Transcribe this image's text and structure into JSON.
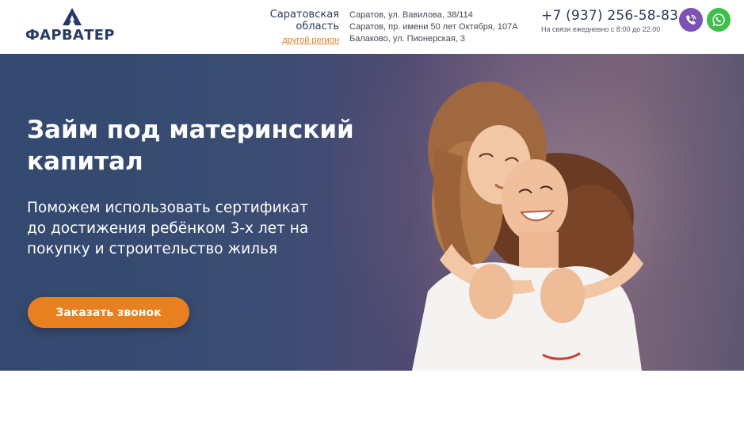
{
  "brand": {
    "name": "ФАРВАТЕР",
    "color": "#253A66"
  },
  "region": {
    "name": "Саратовская область",
    "change_link": "другой регион"
  },
  "addresses": [
    "Саратов, ул. Вавилова, 38/114",
    "Саратов, пр. имени 50 лет Октября, 107А",
    "Балаково, ул. Пионерская, 3"
  ],
  "contact": {
    "phone": "+7 (937) 256-58-83",
    "hours": "На связи ежедневно с 8:00 до 22:00",
    "messengers": [
      {
        "icon": "viber-icon",
        "color": "#7D52B5"
      },
      {
        "icon": "whatsapp-icon",
        "color": "#3FBE48"
      }
    ]
  },
  "hero": {
    "title": "Займ под материнский капитал",
    "subtitle": "Поможем использовать сертификат до достижения ребёнком 3-х лет на покупку и строительство жилья",
    "cta_label": "Заказать звонок",
    "cta_color": "#E8801F",
    "image": "mother-and-daughter-photo"
  }
}
